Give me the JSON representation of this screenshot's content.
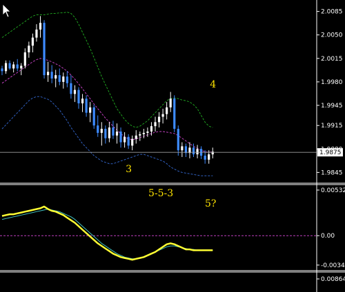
{
  "colors": {
    "background": "#000000",
    "bull": "#ffffff",
    "bear": "#3d8bff",
    "doji": "#2ecc40",
    "band_upper": "#1fa01f",
    "band_middle": "#c040c0",
    "band_lower": "#3060c0",
    "macd_main": "#ffff33",
    "macd_signal": "#40c0c0",
    "zero_line": "#c040c0",
    "annotation": "#ffe400",
    "axis": "#ffffff",
    "price_line": "#a0a0a0"
  },
  "price_panel": {
    "ticks": [
      "2.0085",
      "2.0050",
      "2.0015",
      "1.9980",
      "1.9945",
      "1.9915",
      "1.9880",
      "1.9845"
    ],
    "current_price": "1.9875",
    "ylim": [
      1.983,
      2.01
    ]
  },
  "macd_panel": {
    "ticks": [
      "0.00532",
      "0.00",
      "-0.00343"
    ],
    "ylim": [
      -0.004,
      0.0058
    ]
  },
  "bottom_panel": {
    "ticks": [
      "0.00864"
    ]
  },
  "annotations": [
    {
      "text": "4",
      "bar": 55,
      "price": 1.99715
    },
    {
      "text": "3",
      "bar": 33,
      "price": 1.98455
    },
    {
      "text": "5-5-3",
      "panel_text": true
    },
    {
      "text": "5?",
      "panel_text": true
    }
  ],
  "chart_data": [
    {
      "type": "candlestick",
      "title": "",
      "y_ticks": [
        "2.0085",
        "2.0050",
        "2.0015",
        "1.9980",
        "1.9945",
        "1.9915",
        "1.9880",
        "1.9845"
      ],
      "ylim": [
        1.983,
        2.01
      ],
      "current_price": 1.9875,
      "candles": [
        [
          2.0,
          2.0004,
          1.999,
          1.9996
        ],
        [
          1.9996,
          2.0012,
          1.9992,
          2.0008
        ],
        [
          2.0008,
          2.0012,
          1.9998,
          2.0
        ],
        [
          2.0,
          2.001,
          1.9994,
          2.0006
        ],
        [
          2.0006,
          2.0014,
          1.9996,
          2.0
        ],
        [
          2.0,
          2.0008,
          1.999,
          2.0004
        ],
        [
          2.0004,
          2.003,
          2.0,
          2.0024
        ],
        [
          2.0024,
          2.004,
          2.0016,
          2.0034
        ],
        [
          2.0034,
          2.0052,
          2.0024,
          2.0046
        ],
        [
          2.0046,
          2.0066,
          2.004,
          2.0058
        ],
        [
          2.0058,
          2.0078,
          2.0046,
          2.0068
        ],
        [
          2.0068,
          2.0072,
          1.9985,
          1.999
        ],
        [
          1.999,
          2.001,
          1.998,
          1.9995
        ],
        [
          1.9995,
          2.0005,
          1.9978,
          1.9985
        ],
        [
          1.9985,
          1.9998,
          1.9972,
          1.999
        ],
        [
          1.999,
          2.0,
          1.9975,
          1.998
        ],
        [
          1.998,
          1.9994,
          1.997,
          1.9988
        ],
        [
          1.9988,
          1.9996,
          1.9972,
          1.9978
        ],
        [
          1.9978,
          1.999,
          1.9955,
          1.9962
        ],
        [
          1.9962,
          1.9975,
          1.995,
          1.9968
        ],
        [
          1.9968,
          1.9972,
          1.994,
          1.9948
        ],
        [
          1.9948,
          1.9962,
          1.9935,
          1.9955
        ],
        [
          1.9955,
          1.996,
          1.9928,
          1.9934
        ],
        [
          1.9934,
          1.995,
          1.992,
          1.9942
        ],
        [
          1.9942,
          1.9946,
          1.991,
          1.9915
        ],
        [
          1.9915,
          1.993,
          1.9898,
          1.9904
        ],
        [
          1.9904,
          1.992,
          1.9885,
          1.991
        ],
        [
          1.991,
          1.9915,
          1.9888,
          1.9896
        ],
        [
          1.9896,
          1.992,
          1.989,
          1.9912
        ],
        [
          1.9912,
          1.9922,
          1.9895,
          1.99
        ],
        [
          1.99,
          1.9918,
          1.9888,
          1.9906
        ],
        [
          1.9906,
          1.9912,
          1.9882,
          1.989
        ],
        [
          1.989,
          1.9905,
          1.9882,
          1.9898
        ],
        [
          1.9898,
          1.9902,
          1.988,
          1.9885
        ],
        [
          1.9885,
          1.99,
          1.9878,
          1.9895
        ],
        [
          1.9895,
          1.9908,
          1.9888,
          1.99
        ],
        [
          1.99,
          1.9906,
          1.9892,
          1.9902
        ],
        [
          1.9902,
          1.991,
          1.9896,
          1.9904
        ],
        [
          1.9904,
          1.9912,
          1.9898,
          1.9906
        ],
        [
          1.9906,
          1.992,
          1.99,
          1.9914
        ],
        [
          1.9914,
          1.9928,
          1.9906,
          1.992
        ],
        [
          1.992,
          1.9935,
          1.9912,
          1.9928
        ],
        [
          1.9928,
          1.994,
          1.9918,
          1.9932
        ],
        [
          1.9932,
          1.995,
          1.9924,
          1.9942
        ],
        [
          1.9942,
          1.9965,
          1.9935,
          1.9955
        ],
        [
          1.9955,
          1.996,
          1.9905,
          1.991
        ],
        [
          1.991,
          1.9915,
          1.987,
          1.9878
        ],
        [
          1.9878,
          1.989,
          1.9868,
          1.9884
        ],
        [
          1.9884,
          1.9888,
          1.9868,
          1.9874
        ],
        [
          1.9874,
          1.989,
          1.9866,
          1.9882
        ],
        [
          1.9882,
          1.9888,
          1.9868,
          1.9872
        ],
        [
          1.9872,
          1.9886,
          1.9866,
          1.988
        ],
        [
          1.988,
          1.9884,
          1.9865,
          1.987
        ],
        [
          1.987,
          1.9878,
          1.9858,
          1.9864
        ],
        [
          1.9864,
          1.9878,
          1.9858,
          1.9872
        ],
        [
          1.9872,
          1.9882,
          1.9866,
          1.9876
        ]
      ],
      "bollinger_upper": [
        2.0046,
        2.005,
        2.0054,
        2.0058,
        2.0062,
        2.0066,
        2.007,
        2.0074,
        2.0078,
        2.008,
        2.008,
        2.008,
        2.0081,
        2.0082,
        2.0082,
        2.0083,
        2.0083,
        2.0084,
        2.0082,
        2.0076,
        2.0066,
        2.0054,
        2.0042,
        2.003,
        2.0016,
        2.0002,
        1.9988,
        1.9976,
        1.9964,
        1.9952,
        1.994,
        1.9932,
        1.9924,
        1.9918,
        1.9914,
        1.9912,
        1.9914,
        1.9918,
        1.9922,
        1.9928,
        1.9934,
        1.994,
        1.9946,
        1.9952,
        1.9955,
        1.9956,
        1.9955,
        1.9953,
        1.9952,
        1.995,
        1.9946,
        1.994,
        1.993,
        1.992,
        1.9914,
        1.9912
      ],
      "bollinger_middle": [
        1.9978,
        1.9982,
        1.9986,
        1.999,
        1.9994,
        1.9998,
        2.0002,
        2.0006,
        2.001,
        2.0013,
        2.0015,
        2.0014,
        2.0012,
        2.001,
        2.0007,
        2.0004,
        2.0,
        1.9996,
        1.999,
        1.9984,
        1.9977,
        1.997,
        1.9962,
        1.9955,
        1.9947,
        1.994,
        1.9933,
        1.9926,
        1.992,
        1.9914,
        1.9908,
        1.9903,
        1.9898,
        1.9895,
        1.9894,
        1.9895,
        1.9897,
        1.9899,
        1.9901,
        1.9903,
        1.9905,
        1.9906,
        1.9906,
        1.9905,
        1.9904,
        1.9903,
        1.99,
        1.9896,
        1.9892,
        1.9888,
        1.9884,
        1.9881,
        1.9878,
        1.9876,
        1.9875,
        1.9876
      ],
      "bollinger_lower": [
        1.991,
        1.9916,
        1.9922,
        1.9928,
        1.9934,
        1.994,
        1.9946,
        1.9952,
        1.9956,
        1.9958,
        1.9958,
        1.9956,
        1.9954,
        1.995,
        1.9944,
        1.9938,
        1.993,
        1.9922,
        1.9912,
        1.9904,
        1.9896,
        1.9888,
        1.9882,
        1.9876,
        1.987,
        1.9866,
        1.9862,
        1.986,
        1.9858,
        1.9858,
        1.986,
        1.9862,
        1.9864,
        1.9866,
        1.9868,
        1.987,
        1.9872,
        1.9872,
        1.987,
        1.9868,
        1.9866,
        1.9864,
        1.9862,
        1.9858,
        1.9853,
        1.985,
        1.9847,
        1.9845,
        1.9844,
        1.9843,
        1.9842,
        1.9841,
        1.984,
        1.984,
        1.984,
        1.984
      ]
    },
    {
      "type": "line",
      "title": "",
      "y_ticks": [
        "0.00532",
        "0.00",
        "-0.00343"
      ],
      "ylim": [
        -0.004,
        0.0058
      ],
      "series": [
        {
          "values": [
            0.0023,
            0.0024,
            0.0025,
            0.0025,
            0.0026,
            0.0027,
            0.0028,
            0.0029,
            0.003,
            0.0031,
            0.0032,
            0.0034,
            0.0031,
            0.0029,
            0.0028,
            0.0026,
            0.0024,
            0.0021,
            0.0018,
            0.0015,
            0.0011,
            0.0007,
            0.0003,
            -0.0001,
            -0.0005,
            -0.0009,
            -0.0012,
            -0.0015,
            -0.0018,
            -0.0021,
            -0.0023,
            -0.0025,
            -0.0026,
            -0.0027,
            -0.0028,
            -0.0027,
            -0.0026,
            -0.0025,
            -0.0023,
            -0.0021,
            -0.0019,
            -0.0016,
            -0.0013,
            -0.001,
            -0.0009,
            -0.001,
            -0.0012,
            -0.0014,
            -0.0016,
            -0.0016,
            -0.0017,
            -0.0017,
            -0.0017,
            -0.0017,
            -0.0017,
            -0.0017
          ]
        },
        {
          "values": [
            0.0019,
            0.002,
            0.0021,
            0.0022,
            0.0023,
            0.0024,
            0.0025,
            0.0026,
            0.0027,
            0.0028,
            0.0029,
            0.003,
            0.0031,
            0.003,
            0.0029,
            0.0028,
            0.0026,
            0.0024,
            0.0022,
            0.0019,
            0.0015,
            0.0011,
            0.0007,
            0.0003,
            -0.0001,
            -0.0005,
            -0.0009,
            -0.0012,
            -0.0015,
            -0.0018,
            -0.0021,
            -0.0023,
            -0.0025,
            -0.0026,
            -0.0027,
            -0.0027,
            -0.0026,
            -0.0025,
            -0.0023,
            -0.0021,
            -0.0019,
            -0.0017,
            -0.0015,
            -0.0013,
            -0.0012,
            -0.0012,
            -0.0013,
            -0.0014,
            -0.0015,
            -0.0016,
            -0.0016,
            -0.0017,
            -0.0017,
            -0.0017,
            -0.0017,
            -0.0017
          ]
        }
      ]
    }
  ]
}
